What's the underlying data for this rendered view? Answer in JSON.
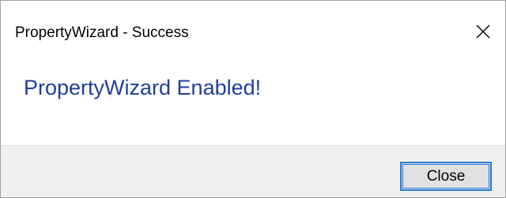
{
  "window": {
    "title": "PropertyWizard - Success",
    "close_icon": "close-icon"
  },
  "content": {
    "message": "PropertyWizard Enabled!"
  },
  "footer": {
    "close_label": "Close"
  },
  "colors": {
    "message_text": "#1f3f99",
    "footer_background": "#f0f0f0",
    "button_focus_border": "#2a7ad5"
  }
}
